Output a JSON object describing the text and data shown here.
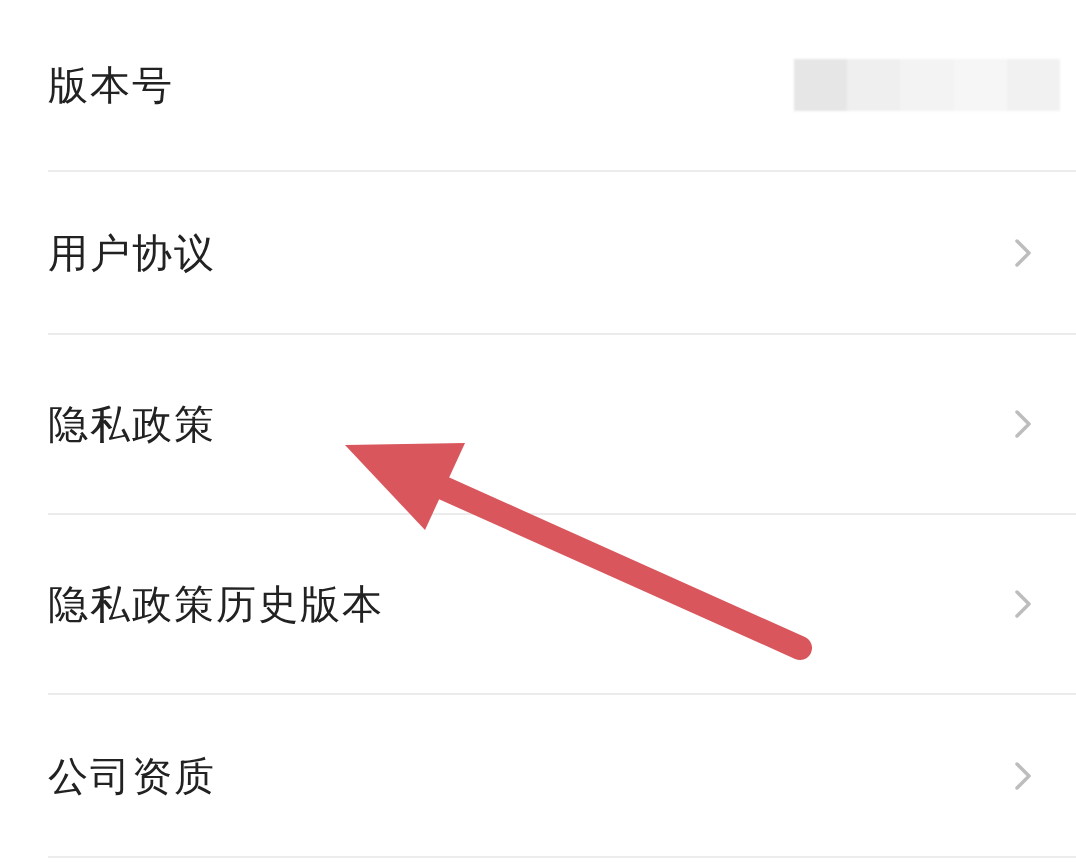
{
  "rows": [
    {
      "label": "版本号",
      "kind": "value"
    },
    {
      "label": "用户协议",
      "kind": "link"
    },
    {
      "label": "隐私政策",
      "kind": "link"
    },
    {
      "label": "隐私政策历史版本",
      "kind": "link"
    },
    {
      "label": "公司资质",
      "kind": "link"
    }
  ],
  "annotation": {
    "kind": "arrow"
  }
}
